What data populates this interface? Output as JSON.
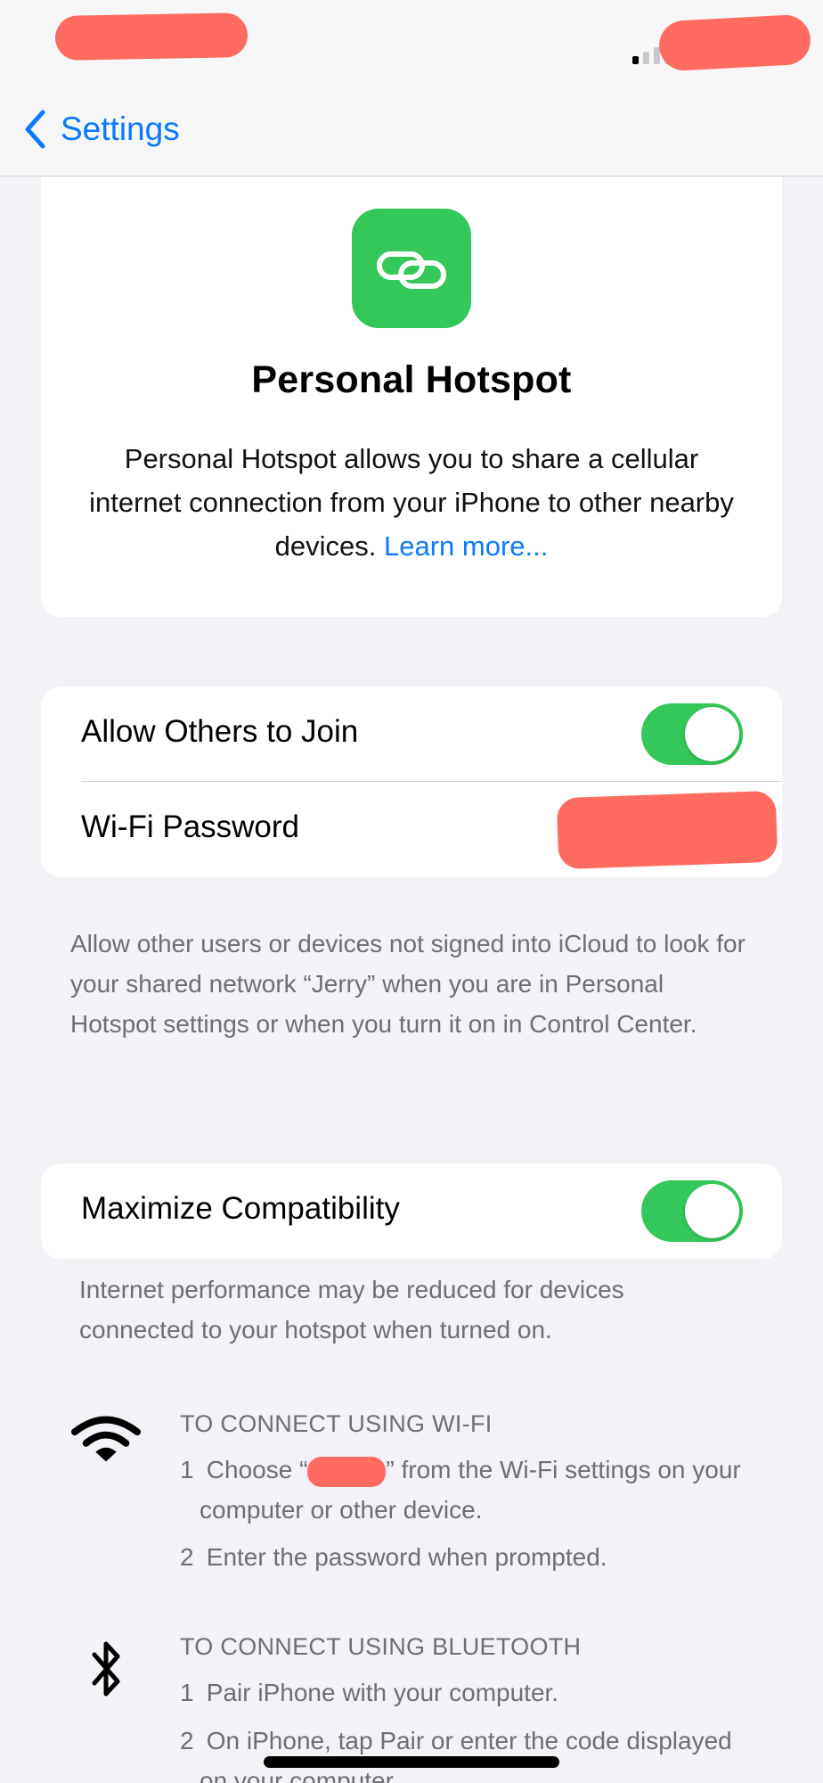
{
  "nav": {
    "back_label": "Settings"
  },
  "hero": {
    "title": "Personal Hotspot",
    "description": "Personal Hotspot allows you to share a cellular internet connection from your iPhone to other nearby devices.",
    "learn_more": "Learn more..."
  },
  "network": {
    "allow_others_label": "Allow Others to Join",
    "allow_others_on": true,
    "wifi_password_label": "Wi-Fi Password",
    "footnote": "Allow other users or devices not signed into iCloud to look for your shared network “Jerry” when you are in Personal Hotspot settings or when you turn it on in Control Center."
  },
  "compatibility": {
    "label": "Maximize Compatibility",
    "on": true,
    "footnote": "Internet performance may be reduced for devices connected to your hotspot when turned on."
  },
  "wifi_help": {
    "title": "TO CONNECT USING WI-FI",
    "step1_num": "1",
    "step1_a": "Choose “",
    "step1_b": "” from the Wi-Fi settings on your",
    "step1_cont": "computer or other device.",
    "step2_num": "2",
    "step2": "Enter the password when prompted."
  },
  "bluetooth_help": {
    "title": "TO CONNECT USING BLUETOOTH",
    "step1_num": "1",
    "step1": "Pair iPhone with your computer.",
    "step2_num": "2",
    "step2": "On iPhone, tap Pair or enter the code displayed",
    "step2_cont": "on your computer."
  },
  "colors": {
    "accent": "#0a7aff",
    "toggle_on": "#34c759",
    "background": "#f2f2f7",
    "redaction": "#ff6b61"
  },
  "icons": {
    "back": "chevron-left-icon",
    "app": "link-icon",
    "wifi": "wifi-icon",
    "bluetooth": "bluetooth-icon",
    "signal": "cellular-signal-icon"
  }
}
